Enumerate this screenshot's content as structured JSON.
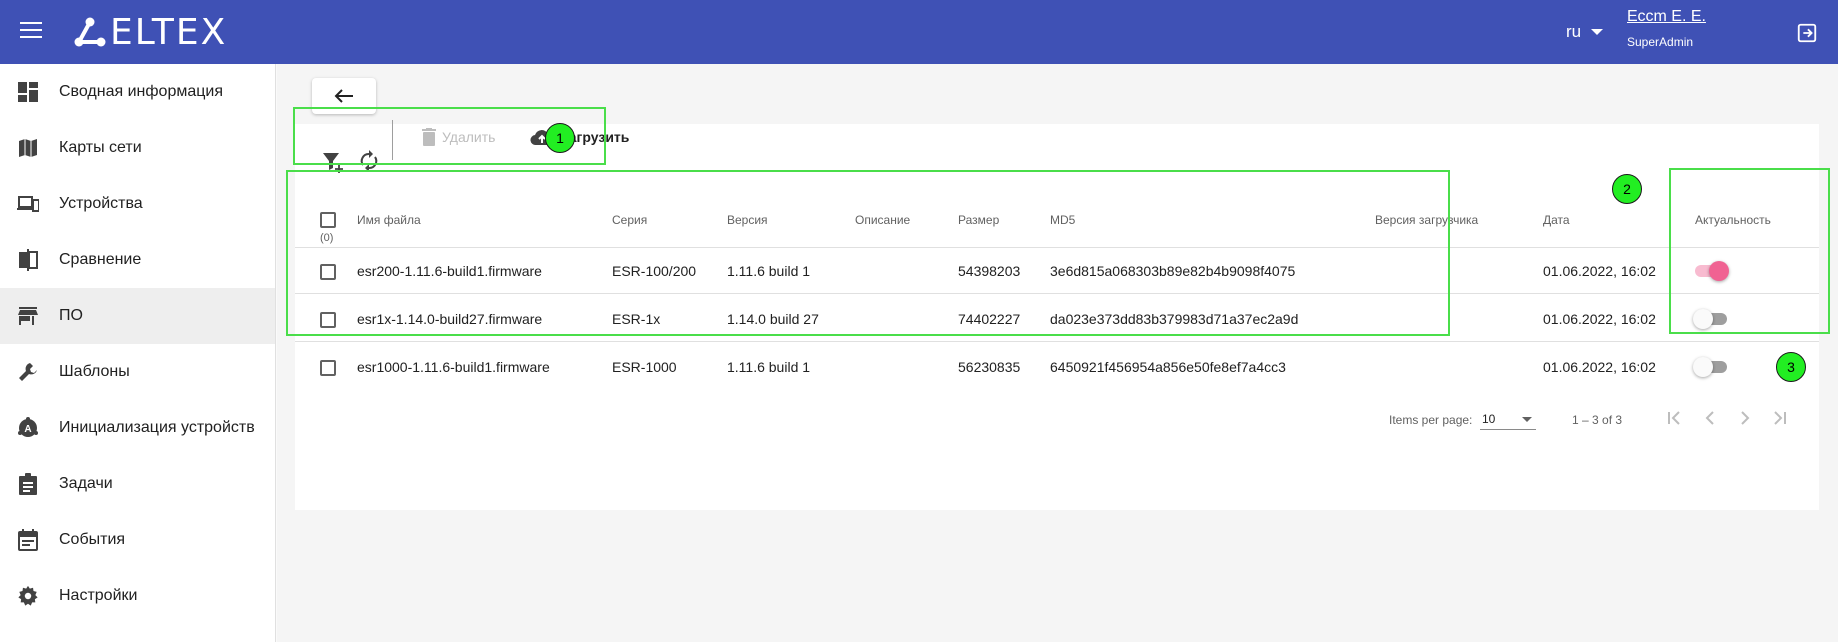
{
  "header": {
    "logo_text": "ELTEX",
    "lang": "ru",
    "user_name": "Есcm Е. Е.",
    "user_role": "SuperAdmin"
  },
  "sidebar": {
    "items": [
      {
        "label": "Сводная информация",
        "icon": "dashboard-icon"
      },
      {
        "label": "Карты сети",
        "icon": "map-icon"
      },
      {
        "label": "Устройства",
        "icon": "devices-icon"
      },
      {
        "label": "Сравнение",
        "icon": "compare-icon"
      },
      {
        "label": "ПО",
        "icon": "store-icon",
        "active": true
      },
      {
        "label": "Шаблоны",
        "icon": "wrench-icon"
      },
      {
        "label": "Инициализация устройств",
        "icon": "init-icon"
      },
      {
        "label": "Задачи",
        "icon": "assignment-icon"
      },
      {
        "label": "События",
        "icon": "event-icon"
      },
      {
        "label": "Настройки",
        "icon": "gear-icon"
      }
    ]
  },
  "toolbar": {
    "delete_label": "Удалить",
    "upload_label": "Загрузить"
  },
  "table": {
    "selected_count": "(0)",
    "columns": {
      "filename": "Имя файла",
      "series": "Серия",
      "version": "Версия",
      "description": "Описание",
      "size": "Размер",
      "md5": "MD5",
      "loader_version": "Версия загрузчика",
      "date": "Дата",
      "actual": "Актуальность"
    },
    "rows": [
      {
        "filename": "esr200-1.11.6-build1.firmware",
        "series": "ESR-100/200",
        "version": "1.11.6 build 1",
        "description": "",
        "size": "54398203",
        "md5": "3e6d815a068303b89e82b4b9098f4075",
        "loader_version": "",
        "date": "01.06.2022, 16:02",
        "actual": true
      },
      {
        "filename": "esr1x-1.14.0-build27.firmware",
        "series": "ESR-1x",
        "version": "1.14.0 build 27",
        "description": "",
        "size": "74402227",
        "md5": "da023e373dd83b379983d71a37ec2a9d",
        "loader_version": "",
        "date": "01.06.2022, 16:02",
        "actual": false
      },
      {
        "filename": "esr1000-1.11.6-build1.firmware",
        "series": "ESR-1000",
        "version": "1.11.6 build 1",
        "description": "",
        "size": "56230835",
        "md5": "6450921f456954a856e50fe8ef7a4cc3",
        "loader_version": "",
        "date": "01.06.2022, 16:02",
        "actual": false
      }
    ]
  },
  "pagination": {
    "items_per_page_label": "Items per page:",
    "page_size": "10",
    "range": "1 – 3 of 3"
  },
  "annotations": {
    "badge1": "1",
    "badge2": "2",
    "badge3": "3",
    "highlight_color": "#4ade4a",
    "badge_color": "#22ee22"
  },
  "colors": {
    "header_bg": "#3f51b5",
    "toggle_on_track": "#f8bbd0",
    "toggle_on_thumb": "#f06292"
  }
}
